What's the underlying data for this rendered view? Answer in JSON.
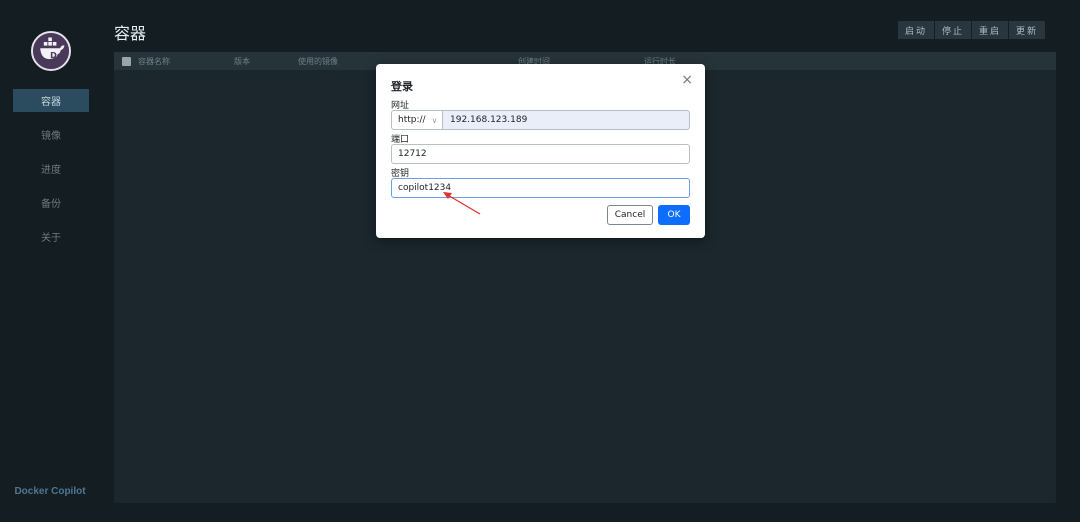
{
  "sidebar": {
    "items": [
      {
        "label": "容器",
        "active": true
      },
      {
        "label": "镜像"
      },
      {
        "label": "进度"
      },
      {
        "label": "备份"
      },
      {
        "label": "关于"
      }
    ],
    "brand": "Docker Copilot"
  },
  "header": {
    "title": "容器",
    "toolbar": [
      "启动",
      "停止",
      "重启",
      "更新"
    ]
  },
  "table": {
    "columns": [
      "容器名称",
      "版本",
      "使用的镜像",
      "创建时间",
      "运行时长"
    ]
  },
  "modal": {
    "title": "登录",
    "close_symbol": "×",
    "url_label": "网址",
    "protocol": "http://",
    "host": "192.168.123.189",
    "port_label": "端口",
    "port": "12712",
    "secret_label": "密钥",
    "secret": "copilot1234",
    "cancel_label": "Cancel",
    "ok_label": "OK"
  },
  "colors": {
    "accent": "#0d6efd",
    "sidebar_active": "#2b4b5e",
    "annotation_arrow": "#e0332e"
  }
}
